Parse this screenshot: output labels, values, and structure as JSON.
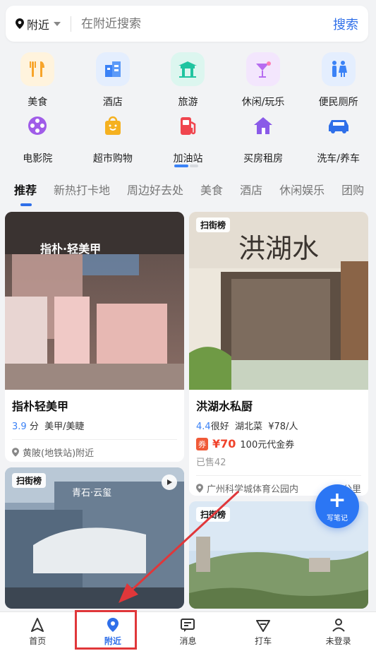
{
  "search": {
    "location": "附近",
    "placeholder": "在附近搜索",
    "button": "搜索"
  },
  "categories": [
    {
      "label": "美食",
      "icon": "food-icon",
      "color": "#f7a42a"
    },
    {
      "label": "酒店",
      "icon": "hotel-icon",
      "color": "#3b82f6"
    },
    {
      "label": "旅游",
      "icon": "travel-icon",
      "color": "#20c4a0"
    },
    {
      "label": "休闲/玩乐",
      "icon": "cocktail-icon",
      "color": "#b66cf0"
    },
    {
      "label": "便民厕所",
      "icon": "toilet-icon",
      "color": "#3b82f6"
    },
    {
      "label": "电影院",
      "icon": "film-icon",
      "color": "#a05ce8"
    },
    {
      "label": "超市购物",
      "icon": "shopping-bag-icon",
      "color": "#f5b120"
    },
    {
      "label": "加油站",
      "icon": "gas-station-icon",
      "color": "#f0454e"
    },
    {
      "label": "买房租房",
      "icon": "house-icon",
      "color": "#8a5ae8"
    },
    {
      "label": "洗车/养车",
      "icon": "car-icon",
      "color": "#2f6fe9"
    }
  ],
  "tabs": [
    "推荐",
    "新热打卡地",
    "周边好去处",
    "美食",
    "酒店",
    "休闲娱乐",
    "团购"
  ],
  "cards": {
    "c1": {
      "title": "指朴轻美甲",
      "score": "3.9",
      "score_unit": "分",
      "tags": "美甲/美睫",
      "location": "黄陂(地铁站)附近"
    },
    "c2": {
      "badge": "扫街榜",
      "title": "洪湖水私厨",
      "score": "4.4",
      "rating_text": "很好",
      "cuisine": "湖北菜",
      "price_per": "¥78/人",
      "coupon_tag": "券",
      "coupon_price": "¥70",
      "coupon_desc": "100元代金券",
      "sold": "已售42",
      "location": "广州科学城体育公园内",
      "distance": "3公里"
    },
    "c3": {
      "badge": "扫街榜",
      "title": "青石·云玺"
    },
    "c4": {
      "badge": "扫街榜"
    }
  },
  "fab": {
    "label": "写笔记"
  },
  "nav": [
    {
      "label": "首页",
      "icon": "home-icon"
    },
    {
      "label": "附近",
      "icon": "location-pin-icon"
    },
    {
      "label": "消息",
      "icon": "message-icon"
    },
    {
      "label": "打车",
      "icon": "taxi-icon"
    },
    {
      "label": "未登录",
      "icon": "user-icon"
    }
  ]
}
